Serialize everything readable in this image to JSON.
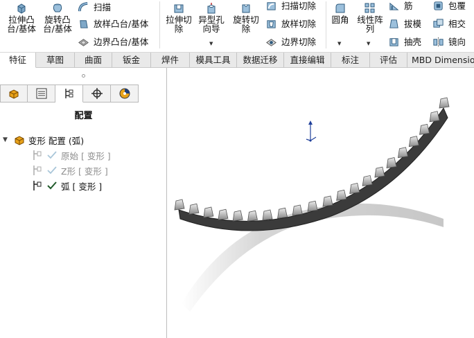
{
  "ribbon": {
    "extrude_boss": "拉伸凸\n台/基体",
    "revolve_boss": "旋转凸\n台/基体",
    "sweep": "扫描",
    "loft_boss": "放样凸台/基体",
    "boundary_boss": "边界凸台/基体",
    "extrude_cut": "拉伸切\n除",
    "hole_wizard": "异型孔\n向导",
    "revolve_cut": "旋转切\n除",
    "swept_cut": "扫描切除",
    "lofted_cut": "放样切除",
    "boundary_cut": "边界切除",
    "fillet": "圆角",
    "linear_pattern": "线性阵\n列",
    "rib": "筋",
    "draft": "拔模",
    "shell": "抽壳",
    "wrap": "包覆",
    "intersect": "相交",
    "mirror": "镜向"
  },
  "tabs": [
    "特征",
    "草图",
    "曲面",
    "钣金",
    "焊件",
    "模具工具",
    "数据迁移",
    "直接编辑",
    "标注",
    "评估",
    "MBD Dimension"
  ],
  "panel": {
    "title": "配置",
    "root": "变形 配置  (弧)",
    "configs": [
      {
        "label": "原始 [ 变形 ]",
        "active": false
      },
      {
        "label": "Z形 [ 变形 ]",
        "active": false
      },
      {
        "label": "弧 [ 变形 ]",
        "active": true
      }
    ]
  },
  "colors": {
    "accent_orange": "#e8a21a",
    "belt_dark": "#3b3b3b",
    "shadow": "#bdbdbd",
    "check_active": "#222222",
    "check_inactive": "#a9c6d9"
  }
}
